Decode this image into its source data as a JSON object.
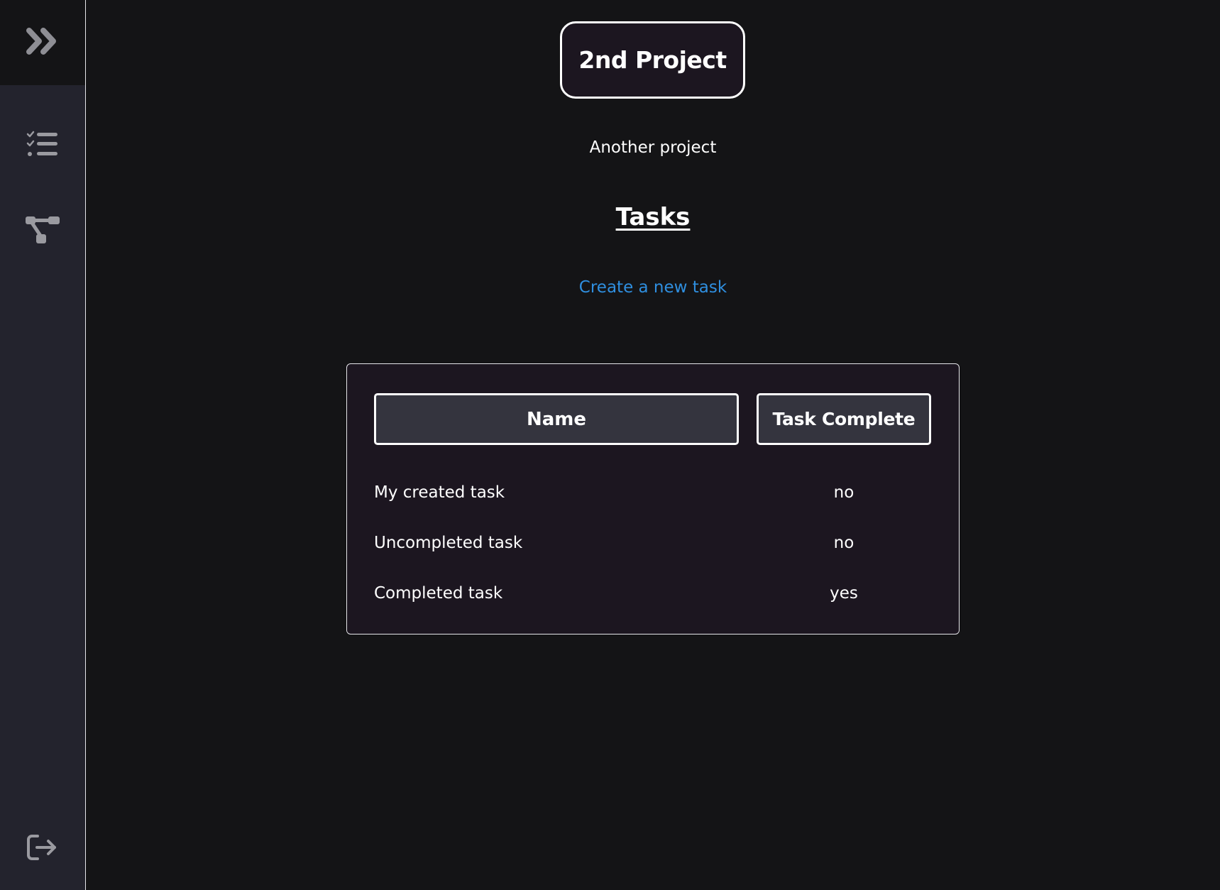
{
  "sidebar": {
    "toggle_icon": "chevron-double-right-icon",
    "items": [
      {
        "icon": "task-list-icon"
      },
      {
        "icon": "hierarchy-tree-icon"
      }
    ],
    "logout_icon": "logout-icon"
  },
  "project": {
    "title": "2nd Project",
    "description": "Another project"
  },
  "tasks_section": {
    "heading": "Tasks",
    "create_link": "Create a new task"
  },
  "table": {
    "columns": [
      "Name",
      "Task Complete"
    ],
    "rows": [
      {
        "name": "My created task",
        "complete": "no"
      },
      {
        "name": "Uncompleted task",
        "complete": "no"
      },
      {
        "name": "Completed task",
        "complete": "yes"
      }
    ]
  },
  "colors": {
    "background": "#141416",
    "sidebar": "#23232d",
    "card": "#1c1620",
    "header_cell": "#34343e",
    "link": "#2f8fe0",
    "icon": "#9a9aa0"
  }
}
